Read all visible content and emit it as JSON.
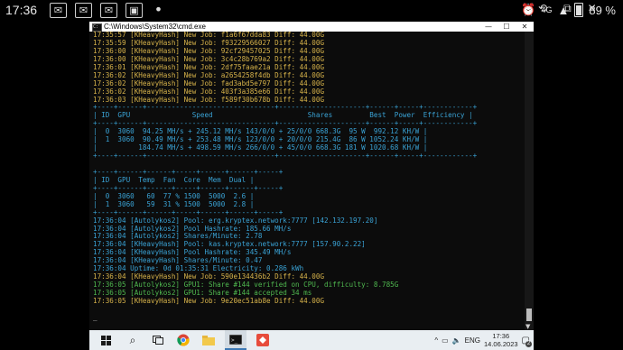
{
  "status_bar": {
    "time": "17:36",
    "battery": "89 %",
    "network": "4G",
    "icons": [
      "mail-icon",
      "mail-icon",
      "mail-icon",
      "photo-icon",
      "dot-icon"
    ]
  },
  "window": {
    "title": "C:\\Windows\\System32\\cmd.exe",
    "buttons": [
      "minimize",
      "maximize",
      "close"
    ]
  },
  "console_lines": [
    {
      "text": "17:35:57 [KHeavyHash] New Job: f1a6f67dda83 Diff: 44.00G",
      "color": "#d6b24a"
    },
    {
      "text": "17:35:59 [KHeavyHash] New Job: f93229566027 Diff: 44.00G",
      "color": "#d6b24a"
    },
    {
      "text": "17:36:00 [KHeavyHash] New Job: 92cf29457025 Diff: 44.00G",
      "color": "#d6b24a"
    },
    {
      "text": "17:36:00 [KHeavyHash] New Job: 3c4c28b769a2 Diff: 44.00G",
      "color": "#d6b24a"
    },
    {
      "text": "17:36:01 [KHeavyHash] New Job: 2df75faae21a Diff: 44.00G",
      "color": "#d6b24a"
    },
    {
      "text": "17:36:02 [KHeavyHash] New Job: a2654258f4db Diff: 44.00G",
      "color": "#d6b24a"
    },
    {
      "text": "17:36:02 [KHeavyHash] New Job: fad3abd5e797 Diff: 44.00G",
      "color": "#d6b24a"
    },
    {
      "text": "17:36:02 [KHeavyHash] New Job: 403f3a385e66 Diff: 44.00G",
      "color": "#d6b24a"
    },
    {
      "text": "17:36:03 [KHeavyHash] New Job: f589f30b678b Diff: 44.00G",
      "color": "#d6b24a"
    },
    {
      "text": "+----+------+-------------------------------+---------------------+------+-----+------------+",
      "color": "#3aa3d6"
    },
    {
      "text": "| ID  GPU               Speed                       Shares         Best  Power  Efficiency |",
      "color": "#3aa3d6"
    },
    {
      "text": "+----+------+-------------------------------+---------------------+------+-----+------------+",
      "color": "#3aa3d6"
    },
    {
      "text": "|  0  3060  94.25 MH/s + 245.12 MH/s 143/0/0 + 25/0/0 668.3G  95 W  992.12 KH/W |",
      "color": "#3aa3d6"
    },
    {
      "text": "|  1  3060  90.49 MH/s + 253.48 MH/s 123/0/0 + 20/0/0 215.4G  86 W 1052.24 KH/W |",
      "color": "#3aa3d6"
    },
    {
      "text": "|          184.74 MH/s + 498.59 MH/s 266/0/0 + 45/0/0 668.3G 181 W 1020.68 KH/W |",
      "color": "#3aa3d6"
    },
    {
      "text": "+----+------+-------------------------------+---------------------+------+-----+------------+",
      "color": "#3aa3d6"
    },
    {
      "text": "",
      "color": "#3aa3d6"
    },
    {
      "text": "+----+------+------+-----+------+------+-----+",
      "color": "#3aa3d6"
    },
    {
      "text": "| ID  GPU  Temp  Fan  Core  Mem  Dual |",
      "color": "#3aa3d6"
    },
    {
      "text": "+----+------+------+-----+------+------+-----+",
      "color": "#3aa3d6"
    },
    {
      "text": "|  0  3060   60  77 % 1500  5000  2.6 |",
      "color": "#3aa3d6"
    },
    {
      "text": "|  1  3060   59  31 % 1500  5000  2.8 |",
      "color": "#3aa3d6"
    },
    {
      "text": "+----+------+------+-----+------+------+-----+",
      "color": "#3aa3d6"
    },
    {
      "text": "17:36:04 [Autolykos2] Pool: erg.kryptex.network:7777 [142.132.197.20]",
      "color": "#3aa3d6"
    },
    {
      "text": "17:36:04 [Autolykos2] Pool Hashrate: 185.66 MH/s",
      "color": "#3aa3d6"
    },
    {
      "text": "17:36:04 [Autolykos2] Shares/Minute: 2.78",
      "color": "#3aa3d6"
    },
    {
      "text": "17:36:04 [KHeavyHash] Pool: kas.kryptex.network:7777 [157.90.2.22]",
      "color": "#3aa3d6"
    },
    {
      "text": "17:36:04 [KHeavyHash] Pool Hashrate: 345.49 MH/s",
      "color": "#3aa3d6"
    },
    {
      "text": "17:36:04 [KHeavyHash] Shares/Minute: 0.47",
      "color": "#3aa3d6"
    },
    {
      "text": "17:36:04 Uptime: 0d 01:35:31 Electricity: 0.286 kWh",
      "color": "#3aa3d6"
    },
    {
      "text": "17:36:04 [KHeavyHash] New Job: 590e134436b2 Diff: 44.00G",
      "color": "#d6b24a"
    },
    {
      "text": "17:36:05 [Autolykos2] GPU1: Share #144 verified on CPU, difficulty: 8.785G",
      "color": "#4fb84f"
    },
    {
      "text": "17:36:05 [Autolykos2] GPU1: Share #144 accepted 34 ms",
      "color": "#4fb84f"
    },
    {
      "text": "17:36:05 [KHeavyHash] New Job: 9e20ec51ab8e Diff: 44.00G",
      "color": "#d6b24a"
    },
    {
      "text": "",
      "color": "#cccccc"
    },
    {
      "text": "_",
      "color": "#dddddd"
    }
  ],
  "taskbar": {
    "items": [
      "start-button",
      "search-icon",
      "task-view-icon",
      "chrome-icon",
      "file-explorer-icon",
      "cmd-icon",
      "anydesk-icon"
    ],
    "tray_chevron": "^",
    "language": "ENG",
    "time": "17:36",
    "date": "14.06.2023",
    "notification_count": "2"
  },
  "colors": {
    "yellow": "#d6b24a",
    "blue": "#3aa3d6",
    "green": "#4fb84f",
    "console_bg": "#0c0c0c",
    "taskbar_bg": "#e9eef2"
  }
}
